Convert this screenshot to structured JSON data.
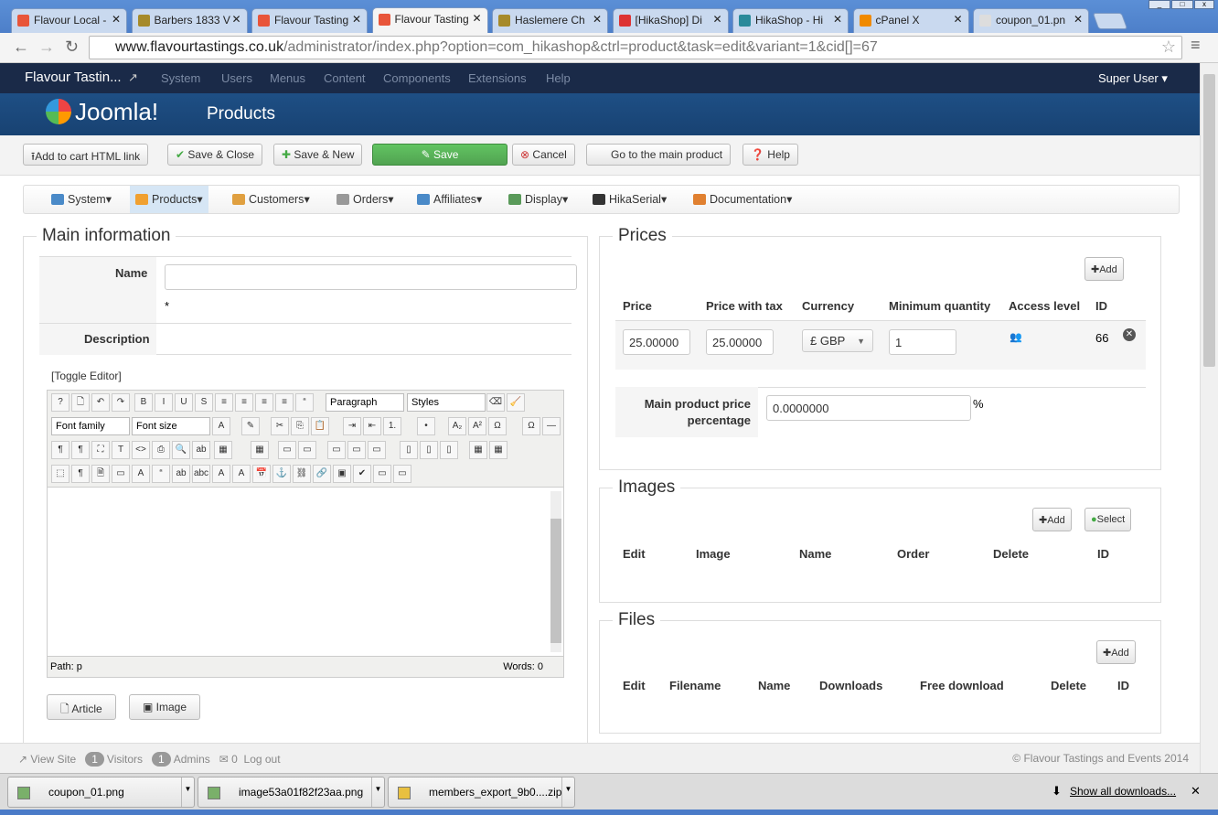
{
  "browser": {
    "tabs": [
      {
        "label": "Flavour Local -",
        "color": "#e8553a"
      },
      {
        "label": "Barbers 1833 V",
        "color": "#a68a2a"
      },
      {
        "label": "Flavour Tasting",
        "color": "#e8553a"
      },
      {
        "label": "Flavour Tasting",
        "color": "#e8553a",
        "active": true
      },
      {
        "label": "Haslemere Ch",
        "color": "#a68a2a"
      },
      {
        "label": "[HikaShop] Di",
        "color": "#d33"
      },
      {
        "label": "HikaShop - Hi",
        "color": "#2a8a9a"
      },
      {
        "label": "cPanel X",
        "color": "#f08a00"
      },
      {
        "label": "coupon_01.pn",
        "color": "#ddd"
      }
    ],
    "url_domain": "www.flavourtastings.co.uk",
    "url_path": "/administrator/index.php?option=com_hikashop&ctrl=product&task=edit&variant=1&cid[]=67"
  },
  "jnav": {
    "site": "Flavour Tastin...",
    "items": [
      "System",
      "Users",
      "Menus",
      "Content",
      "Components",
      "Extensions",
      "Help"
    ],
    "user": "Super User ▾"
  },
  "header": {
    "logo": "Joomla!",
    "title": "Products"
  },
  "toolbar": {
    "add_cart": "Add to cart HTML link",
    "save_close": "Save & Close",
    "save_new": "Save & New",
    "save": "Save",
    "cancel": "Cancel",
    "main_product": "Go to the main product",
    "help": "Help"
  },
  "submenu": [
    {
      "label": "System",
      "color": "#4a8ac8"
    },
    {
      "label": "Products",
      "color": "#f0a030",
      "active": true
    },
    {
      "label": "Customers",
      "color": "#e0a040"
    },
    {
      "label": "Orders",
      "color": "#999"
    },
    {
      "label": "Affiliates",
      "color": "#4a8ac8"
    },
    {
      "label": "Display",
      "color": "#5a9a5a"
    },
    {
      "label": "HikaSerial",
      "color": "#333"
    },
    {
      "label": "Documentation",
      "color": "#e08030"
    }
  ],
  "main": {
    "legend": "Main information",
    "name_label": "Name",
    "name_value": "",
    "required": "*",
    "description_label": "Description",
    "toggle_editor": "[Toggle Editor]",
    "editor": {
      "paragraph": "Paragraph",
      "styles": "Styles",
      "font_family": "Font family",
      "font_size": "Font size",
      "path": "Path:  p",
      "words": "Words: 0"
    },
    "article_btn": "Article",
    "image_btn": "Image"
  },
  "prices": {
    "legend": "Prices",
    "add": "Add",
    "headers": [
      "Price",
      "Price with tax",
      "Currency",
      "Minimum quantity",
      "Access level",
      "ID"
    ],
    "row": {
      "price": "25.00000",
      "price_tax": "25.00000",
      "currency": "£ GBP",
      "min_qty": "1",
      "id": "66"
    },
    "main_pct_label": "Main product price percentage",
    "main_pct_value": "0.0000000",
    "pct": "%"
  },
  "images": {
    "legend": "Images",
    "add": "Add",
    "select": "Select",
    "headers": [
      "Edit",
      "Image",
      "Name",
      "Order",
      "Delete",
      "ID"
    ]
  },
  "files": {
    "legend": "Files",
    "add": "Add",
    "headers": [
      "Edit",
      "Filename",
      "Name",
      "Downloads",
      "Free download",
      "Delete",
      "ID"
    ]
  },
  "footer": {
    "view_site": "View Site",
    "visitors_count": "1",
    "visitors": "Visitors",
    "admins_count": "1",
    "admins": "Admins",
    "messages_count": "0",
    "logout": "Log out",
    "copyright": "© Flavour Tastings and Events 2014"
  },
  "downloads": {
    "items": [
      "coupon_01.png",
      "image53a01f82f23aa.png",
      "members_export_9b0....zip"
    ],
    "show_all": "Show all downloads..."
  }
}
